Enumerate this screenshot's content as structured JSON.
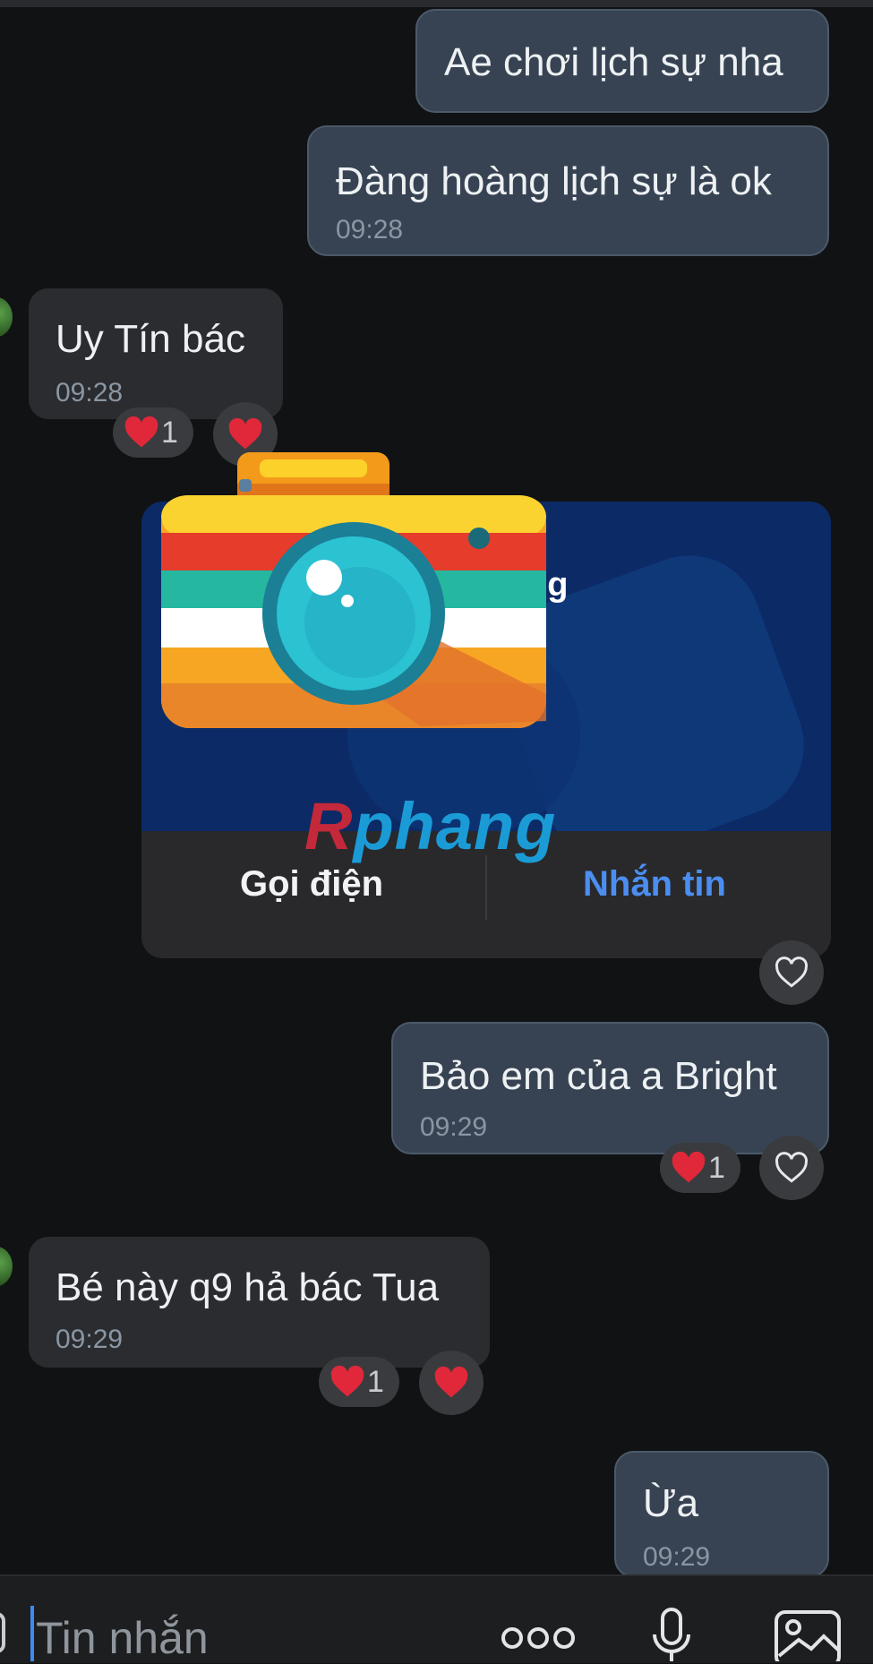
{
  "messages": [
    {
      "text": "Ae chơi lịch sự nha",
      "time": "",
      "direction": "out"
    },
    {
      "text": "Đàng hoàng lịch sự là ok",
      "time": "09:28",
      "direction": "out"
    },
    {
      "text": "Uy Tín bác",
      "time": "09:28",
      "direction": "in",
      "reaction_count": "1"
    },
    {
      "text": "Bảo em của a Bright",
      "time": "09:29",
      "direction": "out",
      "reaction_count": "1"
    },
    {
      "text": "Bé này q9 hả bác Tua",
      "time": "09:29",
      "direction": "in",
      "reaction_count": "1"
    },
    {
      "text": "Ừa",
      "time": "09:29",
      "direction": "out"
    }
  ],
  "contact_card": {
    "name_fragment": "ng",
    "call_label": "Gọi điện",
    "message_label": "Nhắn tin"
  },
  "watermark": {
    "text_red": "R",
    "text_blue": "phang"
  },
  "composer": {
    "placeholder": "Tin nhắn"
  },
  "colors": {
    "background": "#111214",
    "outgoing_bubble": "#374352",
    "incoming_bubble": "#2b2c2f",
    "accent": "#4b8ef0",
    "heart": "#e0283a"
  }
}
